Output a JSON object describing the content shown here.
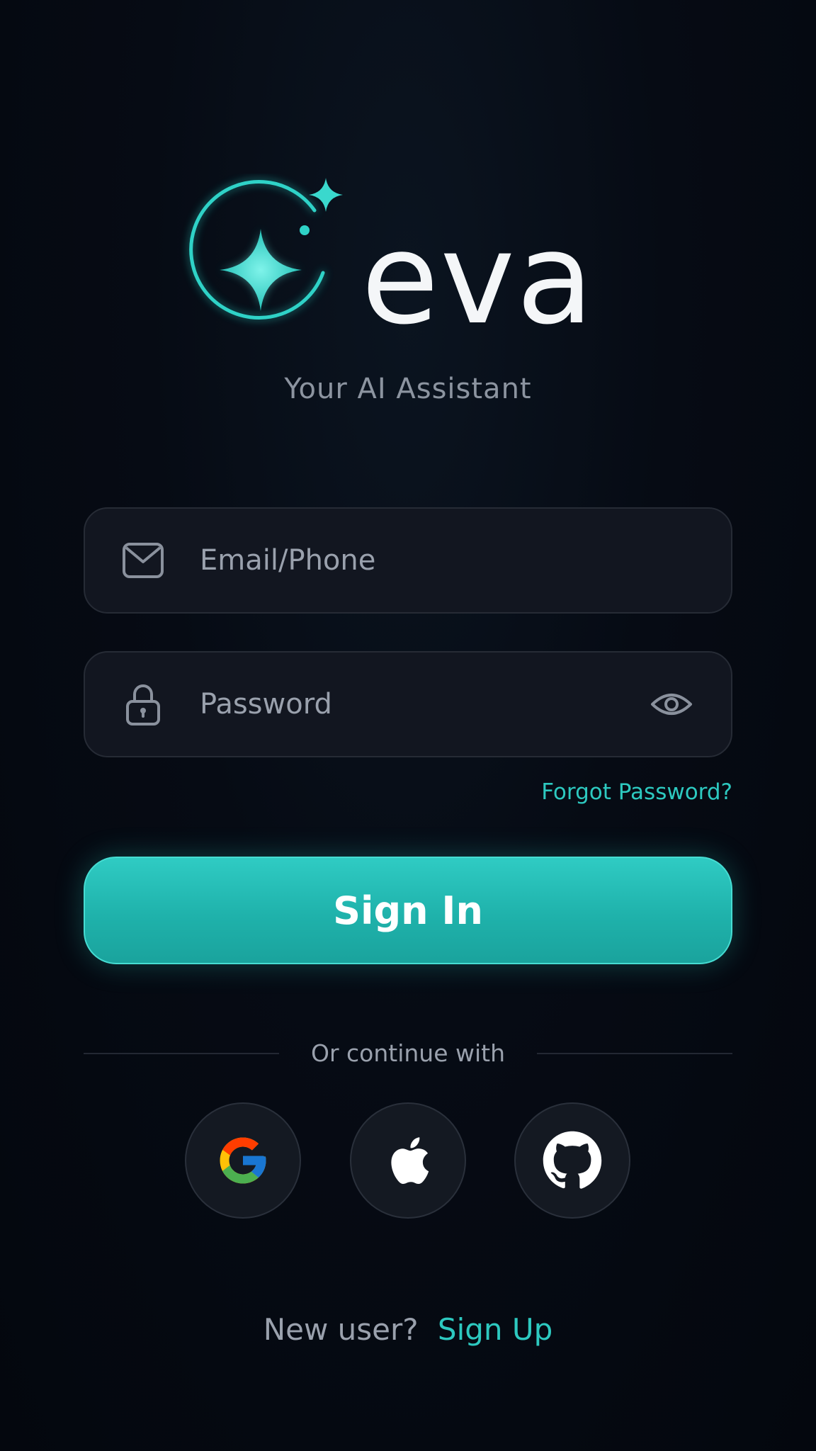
{
  "brand": {
    "name": "eva",
    "tagline": "Your AI Assistant",
    "accent_color": "#2dc9c0",
    "logo_icon": "sparkle-orbit-icon"
  },
  "form": {
    "email": {
      "placeholder": "Email/Phone",
      "value": "",
      "icon": "mail-icon"
    },
    "password": {
      "placeholder": "Password",
      "value": "",
      "icon": "lock-icon",
      "toggle_icon": "eye-icon"
    },
    "forgot_password_label": "Forgot Password?",
    "submit_label": "Sign In"
  },
  "social": {
    "divider_label": "Or continue with",
    "providers": [
      {
        "name": "Google",
        "icon": "google-icon"
      },
      {
        "name": "Apple",
        "icon": "apple-icon"
      },
      {
        "name": "GitHub",
        "icon": "github-icon"
      }
    ]
  },
  "footer": {
    "prompt": "New user?",
    "link_label": "Sign Up"
  }
}
